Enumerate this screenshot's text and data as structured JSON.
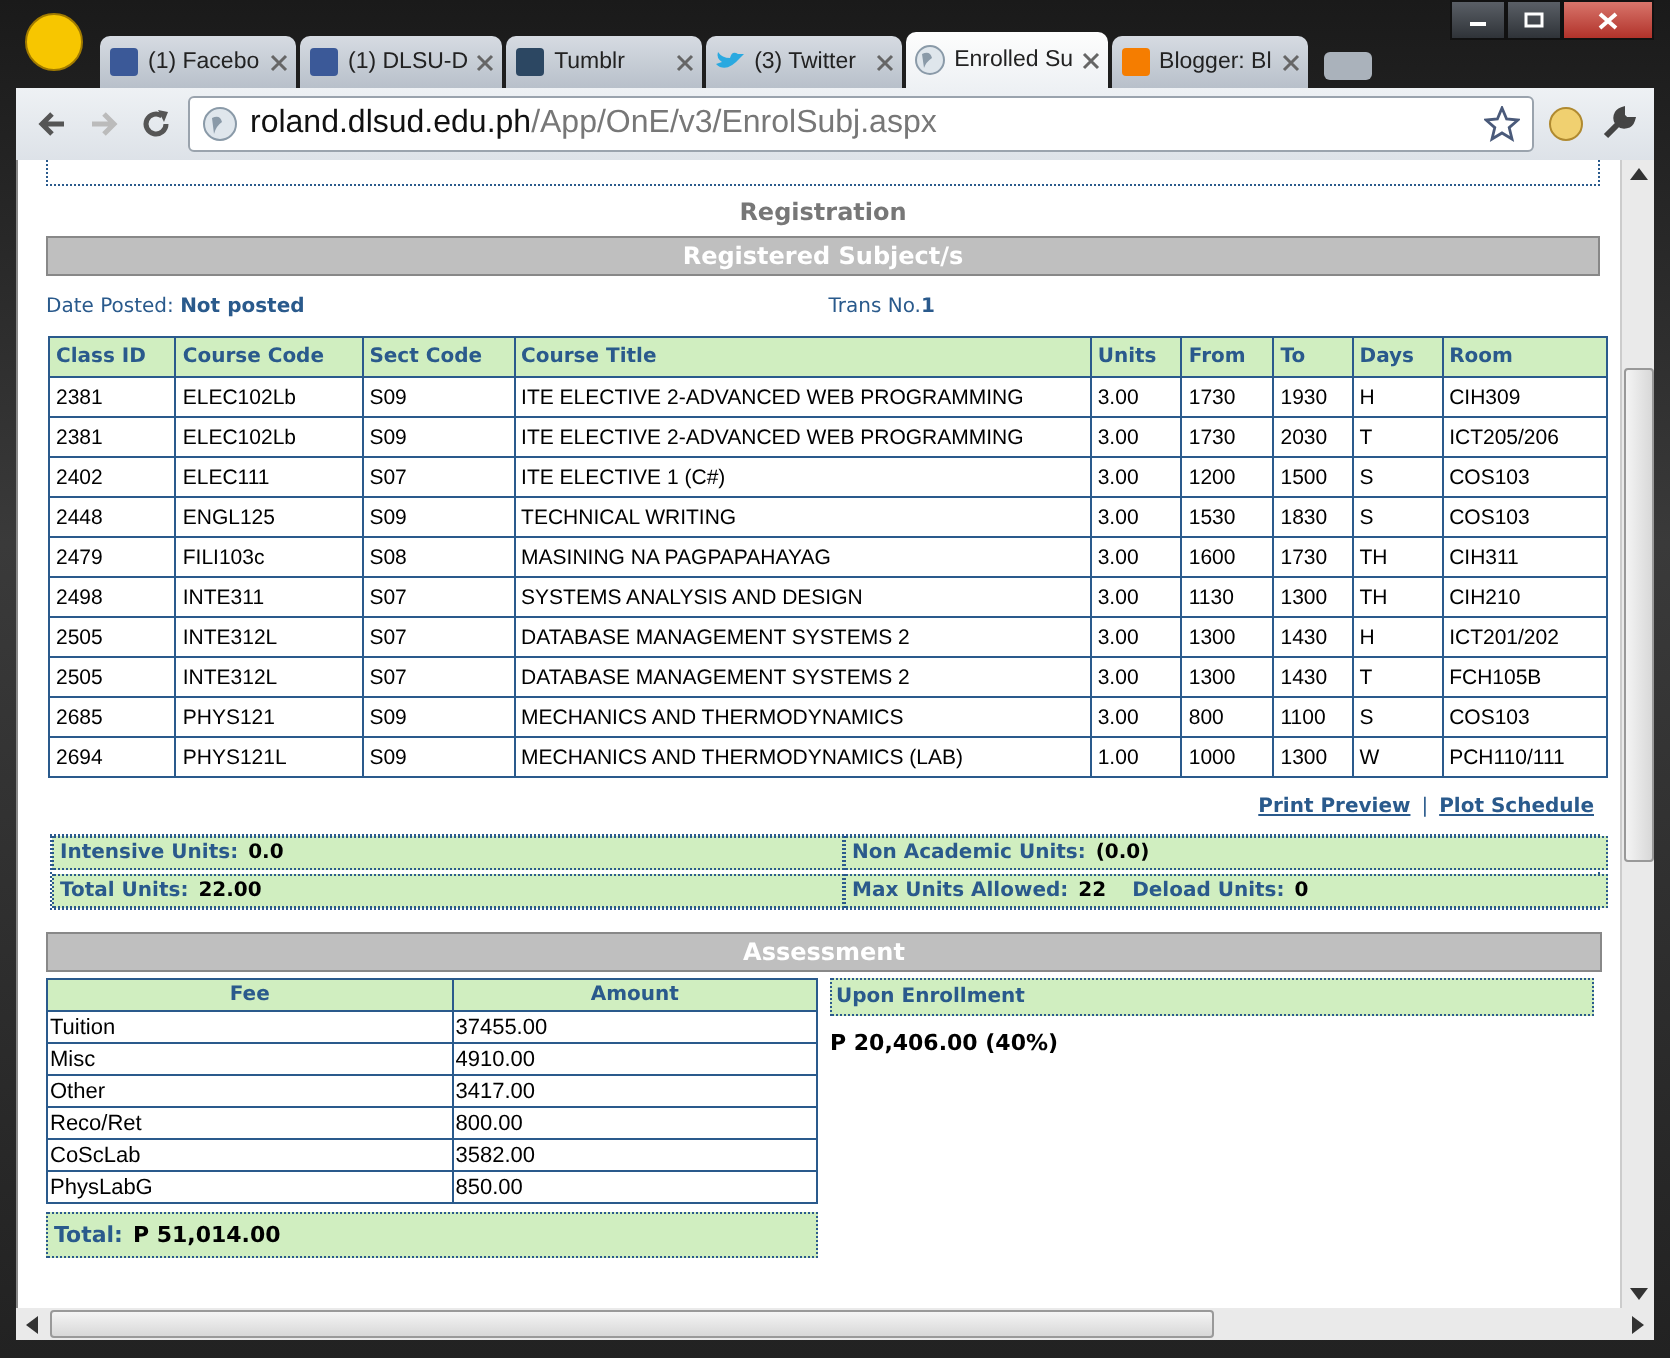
{
  "browser": {
    "tabs": [
      {
        "label": "(1) Facebo",
        "kind": "facebook",
        "selected": false
      },
      {
        "label": "(1) DLSU-D",
        "kind": "facebook",
        "selected": false
      },
      {
        "label": "Tumblr",
        "kind": "tumblr",
        "selected": false
      },
      {
        "label": "(3) Twitter",
        "kind": "twitter",
        "selected": false
      },
      {
        "label": "Enrolled Su",
        "kind": "globe",
        "selected": true
      },
      {
        "label": "Blogger: Bl",
        "kind": "blogger",
        "selected": false
      }
    ],
    "url": {
      "host": "roland.dlsud.edu.ph",
      "path": "/App/OnE/v3/EnrolSubj.aspx"
    }
  },
  "page": {
    "section_title": "Registration",
    "subjects_header": "Registered Subject/s",
    "date_posted": {
      "label": "Date Posted:",
      "value": "Not posted"
    },
    "trans_no": {
      "label": "Trans No.",
      "value": "1"
    },
    "subjects": {
      "columns": [
        "Class ID",
        "Course Code",
        "Sect Code",
        "Course Title",
        "Units",
        "From",
        "To",
        "Days",
        "Room"
      ],
      "rows": [
        [
          "2381",
          "ELEC102Lb",
          "S09",
          "ITE ELECTIVE 2-ADVANCED WEB PROGRAMMING",
          "3.00",
          "1730",
          "1930",
          "H",
          "CIH309"
        ],
        [
          "2381",
          "ELEC102Lb",
          "S09",
          "ITE ELECTIVE 2-ADVANCED WEB PROGRAMMING",
          "3.00",
          "1730",
          "2030",
          "T",
          "ICT205/206"
        ],
        [
          "2402",
          "ELEC111",
          "S07",
          "ITE ELECTIVE 1 (C#)",
          "3.00",
          "1200",
          "1500",
          "S",
          "COS103"
        ],
        [
          "2448",
          "ENGL125",
          "S09",
          "TECHNICAL WRITING",
          "3.00",
          "1530",
          "1830",
          "S",
          "COS103"
        ],
        [
          "2479",
          "FILI103c",
          "S08",
          "MASINING NA PAGPAPAHAYAG",
          "3.00",
          "1600",
          "1730",
          "TH",
          "CIH311"
        ],
        [
          "2498",
          "INTE311",
          "S07",
          "SYSTEMS ANALYSIS AND DESIGN",
          "3.00",
          "1130",
          "1300",
          "TH",
          "CIH210"
        ],
        [
          "2505",
          "INTE312L",
          "S07",
          "DATABASE MANAGEMENT SYSTEMS 2",
          "3.00",
          "1300",
          "1430",
          "H",
          "ICT201/202"
        ],
        [
          "2505",
          "INTE312L",
          "S07",
          "DATABASE MANAGEMENT SYSTEMS 2",
          "3.00",
          "1300",
          "1430",
          "T",
          "FCH105B"
        ],
        [
          "2685",
          "PHYS121",
          "S09",
          "MECHANICS AND THERMODYNAMICS",
          "3.00",
          "800",
          "1100",
          "S",
          "COS103"
        ],
        [
          "2694",
          "PHYS121L",
          "S09",
          "MECHANICS AND THERMODYNAMICS (LAB)",
          "1.00",
          "1000",
          "1300",
          "W",
          "PCH110/111"
        ]
      ]
    },
    "links": [
      "Print Preview",
      "Plot Schedule"
    ],
    "link_separator": "|",
    "units": [
      [
        {
          "label": "Intensive Units:",
          "value": "0.0"
        }
      ],
      [
        {
          "label": "Non Academic Units:",
          "value": "(0.0)"
        }
      ],
      [
        {
          "label": "Total Units:",
          "value": "22.00"
        }
      ],
      [
        {
          "label": "Max Units Allowed:",
          "value": "22"
        },
        {
          "label": "Deload Units:",
          "value": "0"
        }
      ]
    ],
    "assessment_header": "Assessment",
    "fees": {
      "columns": [
        "Fee",
        "Amount"
      ],
      "rows": [
        [
          "Tuition",
          "37455.00"
        ],
        [
          "Misc",
          "4910.00"
        ],
        [
          "Other",
          "3417.00"
        ],
        [
          "Reco/Ret",
          "800.00"
        ],
        [
          "CoScLab",
          "3582.00"
        ],
        [
          "PhysLabG",
          "850.00"
        ]
      ]
    },
    "total": {
      "label": "Total:",
      "value": "P 51,014.00"
    },
    "upon_enrollment": {
      "label": "Upon Enrollment",
      "value": "P 20,406.00 (40%)"
    }
  }
}
